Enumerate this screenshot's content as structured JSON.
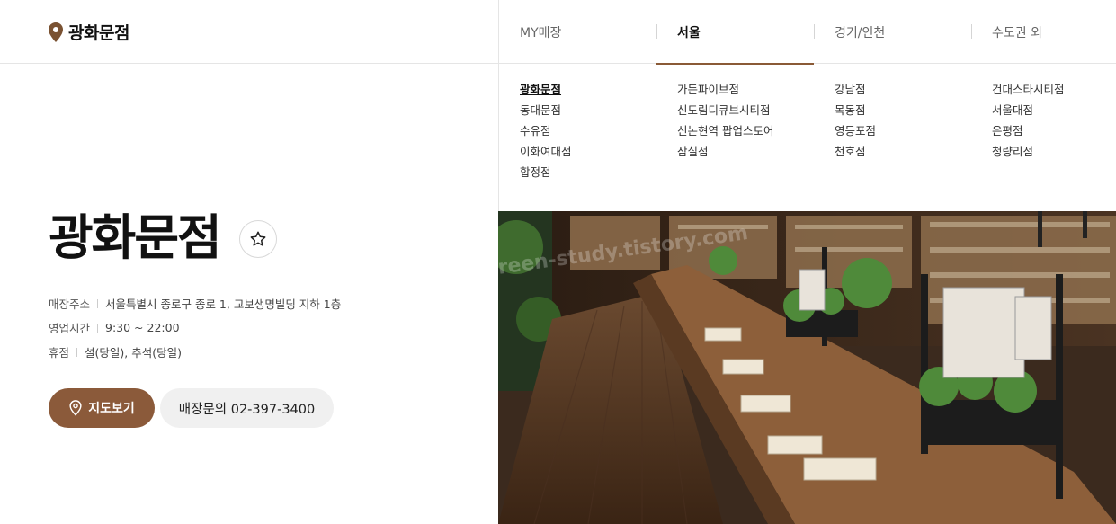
{
  "header": {
    "title": "광화문점",
    "icon": "map-pin-icon"
  },
  "nav": {
    "tabs": [
      {
        "label": "MY매장",
        "active": false
      },
      {
        "label": "서울",
        "active": true
      },
      {
        "label": "경기/인천",
        "active": false
      },
      {
        "label": "수도권 외",
        "active": false
      }
    ],
    "columns": [
      [
        "광화문점",
        "동대문점",
        "수유점",
        "이화여대점",
        "합정점"
      ],
      [
        "가든파이브점",
        "신도림디큐브시티점",
        "신논현역 팝업스토어",
        "잠실점"
      ],
      [
        "강남점",
        "목동점",
        "영등포점",
        "천호점"
      ],
      [
        "건대스타시티점",
        "서울대점",
        "은평점",
        "청량리점"
      ]
    ],
    "current_store": "광화문점",
    "accent_color": "#8a5a36"
  },
  "store": {
    "name": "광화문점",
    "favorite_icon": "star-outline-icon",
    "address_label": "매장주소",
    "address": "서울특별시 종로구 종로 1, 교보생명빌딩 지하 1층",
    "hours_label": "영업시간",
    "hours": "9:30 ~ 22:00",
    "closed_label": "휴점",
    "closed": "설(당일), 추석(당일)"
  },
  "buttons": {
    "map_label": "지도보기",
    "map_icon": "map-pin-icon",
    "phone_label": "매장문의 02-397-3400",
    "map_color": "#8b5a3a"
  },
  "photo": {
    "description_icon": "bookstore-photo",
    "watermark": "green-study.tistory.com"
  }
}
